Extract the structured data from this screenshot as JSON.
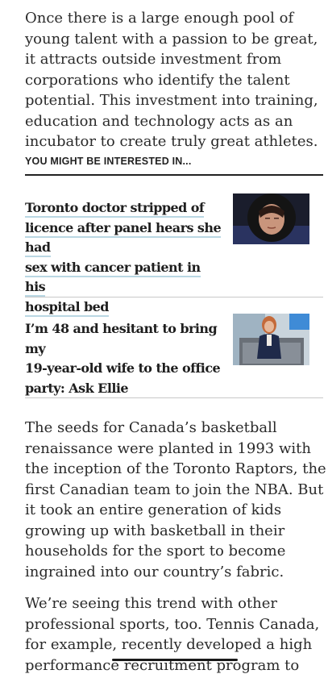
{
  "intro_paragraph": "Once there is a large enough pool of young talent with a passion to be great, it attracts outside investment from corporations who identify the talent potential. This investment into training, education and technology acts as an incubator to create truly great athletes.",
  "related": {
    "heading": "YOU MIGHT BE INTERESTED IN...",
    "articles": [
      {
        "lines": [
          "Toronto doctor stripped of",
          "licence after panel hears she had",
          "sex with cancer patient in his",
          "hospital bed"
        ],
        "thumbnail": "woman-in-fur-hood-photo"
      },
      {
        "lines": [
          "I’m 48 and hesitant to bring my",
          "19-year-old wife to the office",
          "party: Ask Ellie"
        ],
        "thumbnail": "woman-on-tv-set-photo"
      }
    ]
  },
  "body_paragraphs": [
    "The seeds for Canada’s basketball renaissance were planted in 1993 with the inception of the Toronto Raptors, the first Canadian team to join the NBA. But it took an entire generation of kids growing up with basketball in their households for the sport to become ingrained into our country’s fabric.",
    "We’re seeing this trend with other professional sports, too. Tennis Canada, for example, recently developed a high performance recruitment program to"
  ],
  "colors": {
    "link_underline": "#b9d7e3",
    "text": "#2a2a2a",
    "divider": "#c8c8c8"
  }
}
